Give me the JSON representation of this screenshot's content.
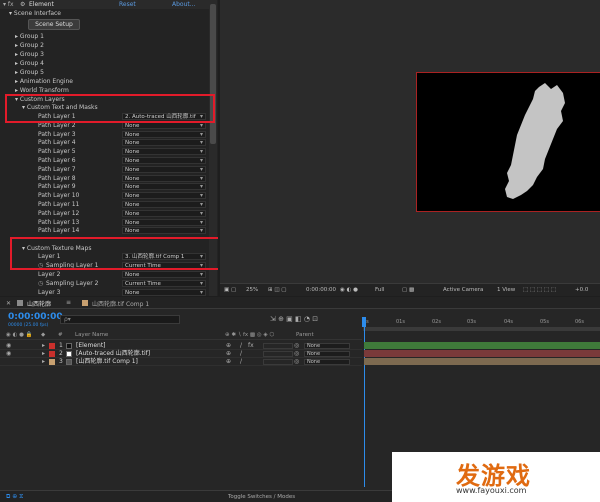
{
  "effects": {
    "title": "Element",
    "reset": "Reset",
    "about": "About...",
    "scene_interface": "Scene Interface",
    "scene_setup": "Scene Setup",
    "groups": [
      "Group 1",
      "Group 2",
      "Group 3",
      "Group 4",
      "Group 5"
    ],
    "animation_engine": "Animation Engine",
    "world_transform": "World Transform",
    "custom_layers": "Custom Layers",
    "custom_text_masks": "Custom Text and Masks",
    "path_layers": [
      {
        "label": "Path Layer 1",
        "value": "2. Auto-traced 山西轮廓.tif"
      },
      {
        "label": "Path Layer 2",
        "value": "None"
      },
      {
        "label": "Path Layer 3",
        "value": "None"
      },
      {
        "label": "Path Layer 4",
        "value": "None"
      },
      {
        "label": "Path Layer 5",
        "value": "None"
      },
      {
        "label": "Path Layer 6",
        "value": "None"
      },
      {
        "label": "Path Layer 7",
        "value": "None"
      },
      {
        "label": "Path Layer 8",
        "value": "None"
      },
      {
        "label": "Path Layer 9",
        "value": "None"
      },
      {
        "label": "Path Layer 10",
        "value": "None"
      },
      {
        "label": "Path Layer 11",
        "value": "None"
      },
      {
        "label": "Path Layer 12",
        "value": "None"
      },
      {
        "label": "Path Layer 13",
        "value": "None"
      },
      {
        "label": "Path Layer 14",
        "value": "None"
      }
    ],
    "custom_texture_maps": "Custom Texture Maps",
    "texture_layers": [
      {
        "label": "Layer 1",
        "value": "3. 山西轮廓.tif Comp 1"
      },
      {
        "label": "Sampling Layer 1",
        "value": "Current Time"
      },
      {
        "label": "Layer 2",
        "value": "None"
      },
      {
        "label": "Sampling Layer 2",
        "value": "Current Time"
      },
      {
        "label": "Layer 3",
        "value": "None"
      }
    ]
  },
  "comp_toolbar": {
    "zoom": "25%",
    "timecode": "0:00:00:00",
    "resolution": "Full",
    "camera": "Active Camera",
    "view": "1 View",
    "offset": "+0.0"
  },
  "timeline": {
    "tab_active": "山西轮廓",
    "tab_other": "山西轮廓.tif Comp 1",
    "current_time": "0:00:00:00",
    "frame_info": "00000 (25.00 fps)",
    "search_placeholder": "ρ▾",
    "col_num": "#",
    "col_layer": "Layer Name",
    "col_parent": "Parent",
    "ruler": [
      "0s",
      "01s",
      "02s",
      "03s",
      "04s",
      "05s",
      "06s"
    ],
    "layers": [
      {
        "num": "1",
        "name": "[Element]",
        "parent": "None",
        "color": "#c9302c"
      },
      {
        "num": "2",
        "name": "[Auto-traced 山西轮廓.tif]",
        "parent": "None",
        "color": "#c9302c"
      },
      {
        "num": "3",
        "name": "[山西轮廓.tif Comp 1]",
        "parent": "None",
        "color": "#c8a070"
      }
    ],
    "toggle": "Toggle Switches / Modes"
  },
  "watermark": {
    "brand": "发游戏",
    "url": "www.fayouxi.com"
  },
  "colors": {
    "highlight": "#e21b2a",
    "accent": "#2d8ceb",
    "track_green": "#3f7a3a",
    "track_red": "#7a3a3a",
    "track_tan": "#7d6a50"
  }
}
